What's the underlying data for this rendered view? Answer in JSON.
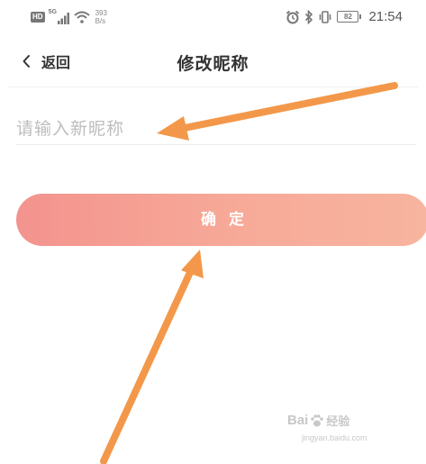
{
  "status_bar": {
    "hd_label": "HD",
    "network_label": "5G",
    "net_speed_value": "393",
    "net_speed_unit": "B/s",
    "battery_level": "82",
    "time": "21:54",
    "icons": [
      "hd-icon",
      "signal-5g-icon",
      "wifi-icon",
      "alarm-icon",
      "bluetooth-icon",
      "vibrate-icon",
      "battery-icon"
    ]
  },
  "header": {
    "back_label": "返回",
    "title": "修改昵称"
  },
  "form": {
    "nickname_placeholder": "请输入新昵称",
    "nickname_value": "",
    "confirm_label": "确定"
  },
  "annotations": {
    "arrow_color": "#f3984a",
    "arrows": [
      "arrow-to-nickname-input",
      "arrow-to-confirm-button"
    ]
  },
  "watermark": {
    "brand": "Bai",
    "brand_suffix": "经验",
    "url": "jingyan.baidu.com"
  },
  "colors": {
    "button_gradient_start": "#f3938e",
    "button_gradient_end": "#f7b49e",
    "title_text": "#333333",
    "placeholder_text": "#bdbdbd"
  }
}
